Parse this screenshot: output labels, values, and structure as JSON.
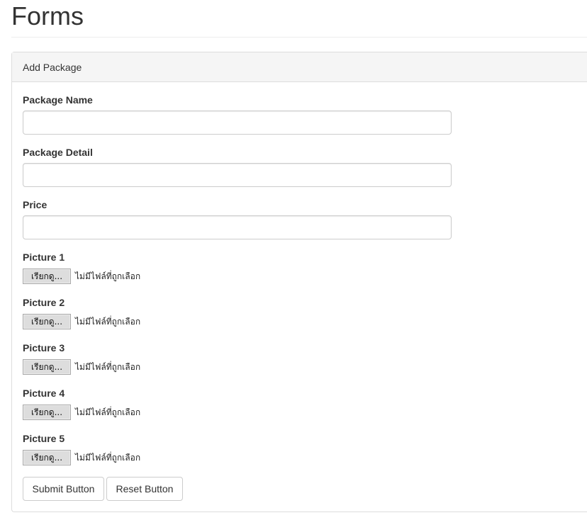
{
  "page": {
    "title": "Forms"
  },
  "panel": {
    "heading": "Add Package"
  },
  "fields": {
    "package_name": {
      "label": "Package Name",
      "value": ""
    },
    "package_detail": {
      "label": "Package Detail",
      "value": ""
    },
    "price": {
      "label": "Price",
      "value": ""
    }
  },
  "pictures": [
    {
      "label": "Picture 1",
      "button": "เรียกดู...",
      "status": "ไม่มีไฟล์ที่ถูกเลือก"
    },
    {
      "label": "Picture 2",
      "button": "เรียกดู...",
      "status": "ไม่มีไฟล์ที่ถูกเลือก"
    },
    {
      "label": "Picture 3",
      "button": "เรียกดู...",
      "status": "ไม่มีไฟล์ที่ถูกเลือก"
    },
    {
      "label": "Picture 4",
      "button": "เรียกดู...",
      "status": "ไม่มีไฟล์ที่ถูกเลือก"
    },
    {
      "label": "Picture 5",
      "button": "เรียกดู...",
      "status": "ไม่มีไฟล์ที่ถูกเลือก"
    }
  ],
  "actions": {
    "submit": "Submit Button",
    "reset": "Reset Button"
  }
}
